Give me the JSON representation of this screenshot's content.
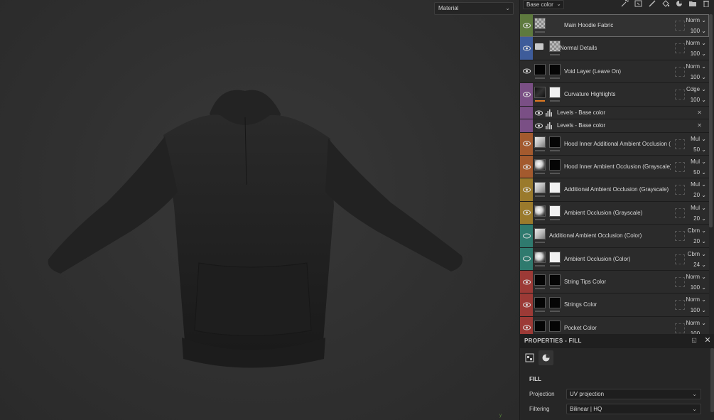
{
  "viewport": {
    "mode": "Material",
    "axis_label": "y"
  },
  "layer_panel": {
    "channel": "Base color",
    "layers": [
      {
        "name": "Main Hoodie Fabric",
        "blend": "Norm",
        "opacity": "100",
        "color": "#5e7a3e",
        "selected": true,
        "thumbs": [
          "checker"
        ]
      },
      {
        "name": "Normal Details",
        "blend": "Norm",
        "opacity": "100",
        "color": "#3e5c9a",
        "folder": true,
        "thumbs": [
          "checker"
        ]
      },
      {
        "name": "Void Layer (Leave On)",
        "blend": "Norm",
        "opacity": "100",
        "color": "#2b2b2b",
        "thumbs": [
          "black",
          "black"
        ]
      },
      {
        "name": "Curvature Highlights",
        "blend": "Cdge",
        "opacity": "100",
        "color": "#7a4f85",
        "thumbs": [
          "curv",
          "white"
        ],
        "accent": "#e07a22"
      },
      {
        "name": "Hood Inner Additional Ambient Occlusion (Grayscale)",
        "display": "Hood Inner Additional Ambient Occlusion (...",
        "blend": "Mul",
        "opacity": "50",
        "color": "#a35a2e",
        "thumbs": [
          "ao2",
          "black"
        ]
      },
      {
        "name": "Hood Inner Ambient Occlusion (Grayscale)",
        "blend": "Mul",
        "opacity": "50",
        "color": "#a35a2e",
        "thumbs": [
          "ao",
          "black"
        ]
      },
      {
        "name": "Additional Ambient Occlusion (Grayscale)",
        "blend": "Mul",
        "opacity": "20",
        "color": "#9a7a2c",
        "thumbs": [
          "ao2",
          "white"
        ]
      },
      {
        "name": "Ambient Occlusion (Grayscale)",
        "blend": "Mul",
        "opacity": "20",
        "color": "#9a7a2c",
        "thumbs": [
          "ao",
          "white"
        ]
      },
      {
        "name": "Additional Ambient Occlusion (Color)",
        "blend": "Cbrn",
        "opacity": "20",
        "color": "#2f7a6e",
        "thumbs": [
          "ao2"
        ]
      },
      {
        "name": "Ambient Occlusion (Color)",
        "blend": "Cbrn",
        "opacity": "24",
        "color": "#2f7a6e",
        "thumbs": [
          "ao",
          "white"
        ]
      },
      {
        "name": "String Tips Color",
        "blend": "Norm",
        "opacity": "100",
        "color": "#9c3a36",
        "thumbs": [
          "black",
          "black"
        ]
      },
      {
        "name": "Strings Color",
        "blend": "Norm",
        "opacity": "100",
        "color": "#9c3a36",
        "thumbs": [
          "black",
          "black"
        ]
      },
      {
        "name": "Pocket Color",
        "blend": "Norm",
        "opacity": "100",
        "color": "#9c3a36",
        "thumbs": [
          "black",
          "black"
        ]
      }
    ],
    "effects": [
      {
        "name": "Levels - Base color",
        "color": "#7a4f85"
      },
      {
        "name": "Levels - Base color",
        "color": "#7a4f85"
      }
    ]
  },
  "properties": {
    "title": "PROPERTIES - FILL",
    "section": "FILL",
    "projection_label": "Projection",
    "projection_value": "UV projection",
    "filtering_label": "Filtering",
    "filtering_value": "Bilinear | HQ"
  },
  "colors": {
    "viewport_bg": "#2f2f2f",
    "panel_bg": "#262626",
    "hoodie": "#1f1f1f"
  }
}
